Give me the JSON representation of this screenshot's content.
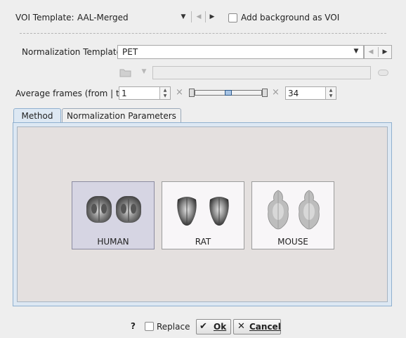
{
  "voi_template": {
    "label": "VOI Template:",
    "value": "AAL-Merged",
    "add_background_label": "Add background as VOI",
    "add_background_checked": false
  },
  "normalization": {
    "label": "Normalization Template",
    "value": "PET",
    "path_value": ""
  },
  "average_frames": {
    "label": "Average frames (from | to)",
    "from": "1",
    "to": "34",
    "x_symbol": "×"
  },
  "tabs": [
    {
      "label": "Method",
      "active": true
    },
    {
      "label": "Normalization Parameters",
      "active": false
    }
  ],
  "species": [
    {
      "label": "HUMAN",
      "selected": true
    },
    {
      "label": "RAT",
      "selected": false
    },
    {
      "label": "MOUSE",
      "selected": false
    }
  ],
  "footer": {
    "help": "?",
    "replace_label": "Replace",
    "replace_checked": false,
    "ok_label": "Ok",
    "cancel_label": "Cancel"
  },
  "colors": {
    "panel_bg": "#e4e0df",
    "panel_border": "#8fb0cf",
    "tab_active": "#dde8f3",
    "selected_tile": "#d6d5e3"
  }
}
